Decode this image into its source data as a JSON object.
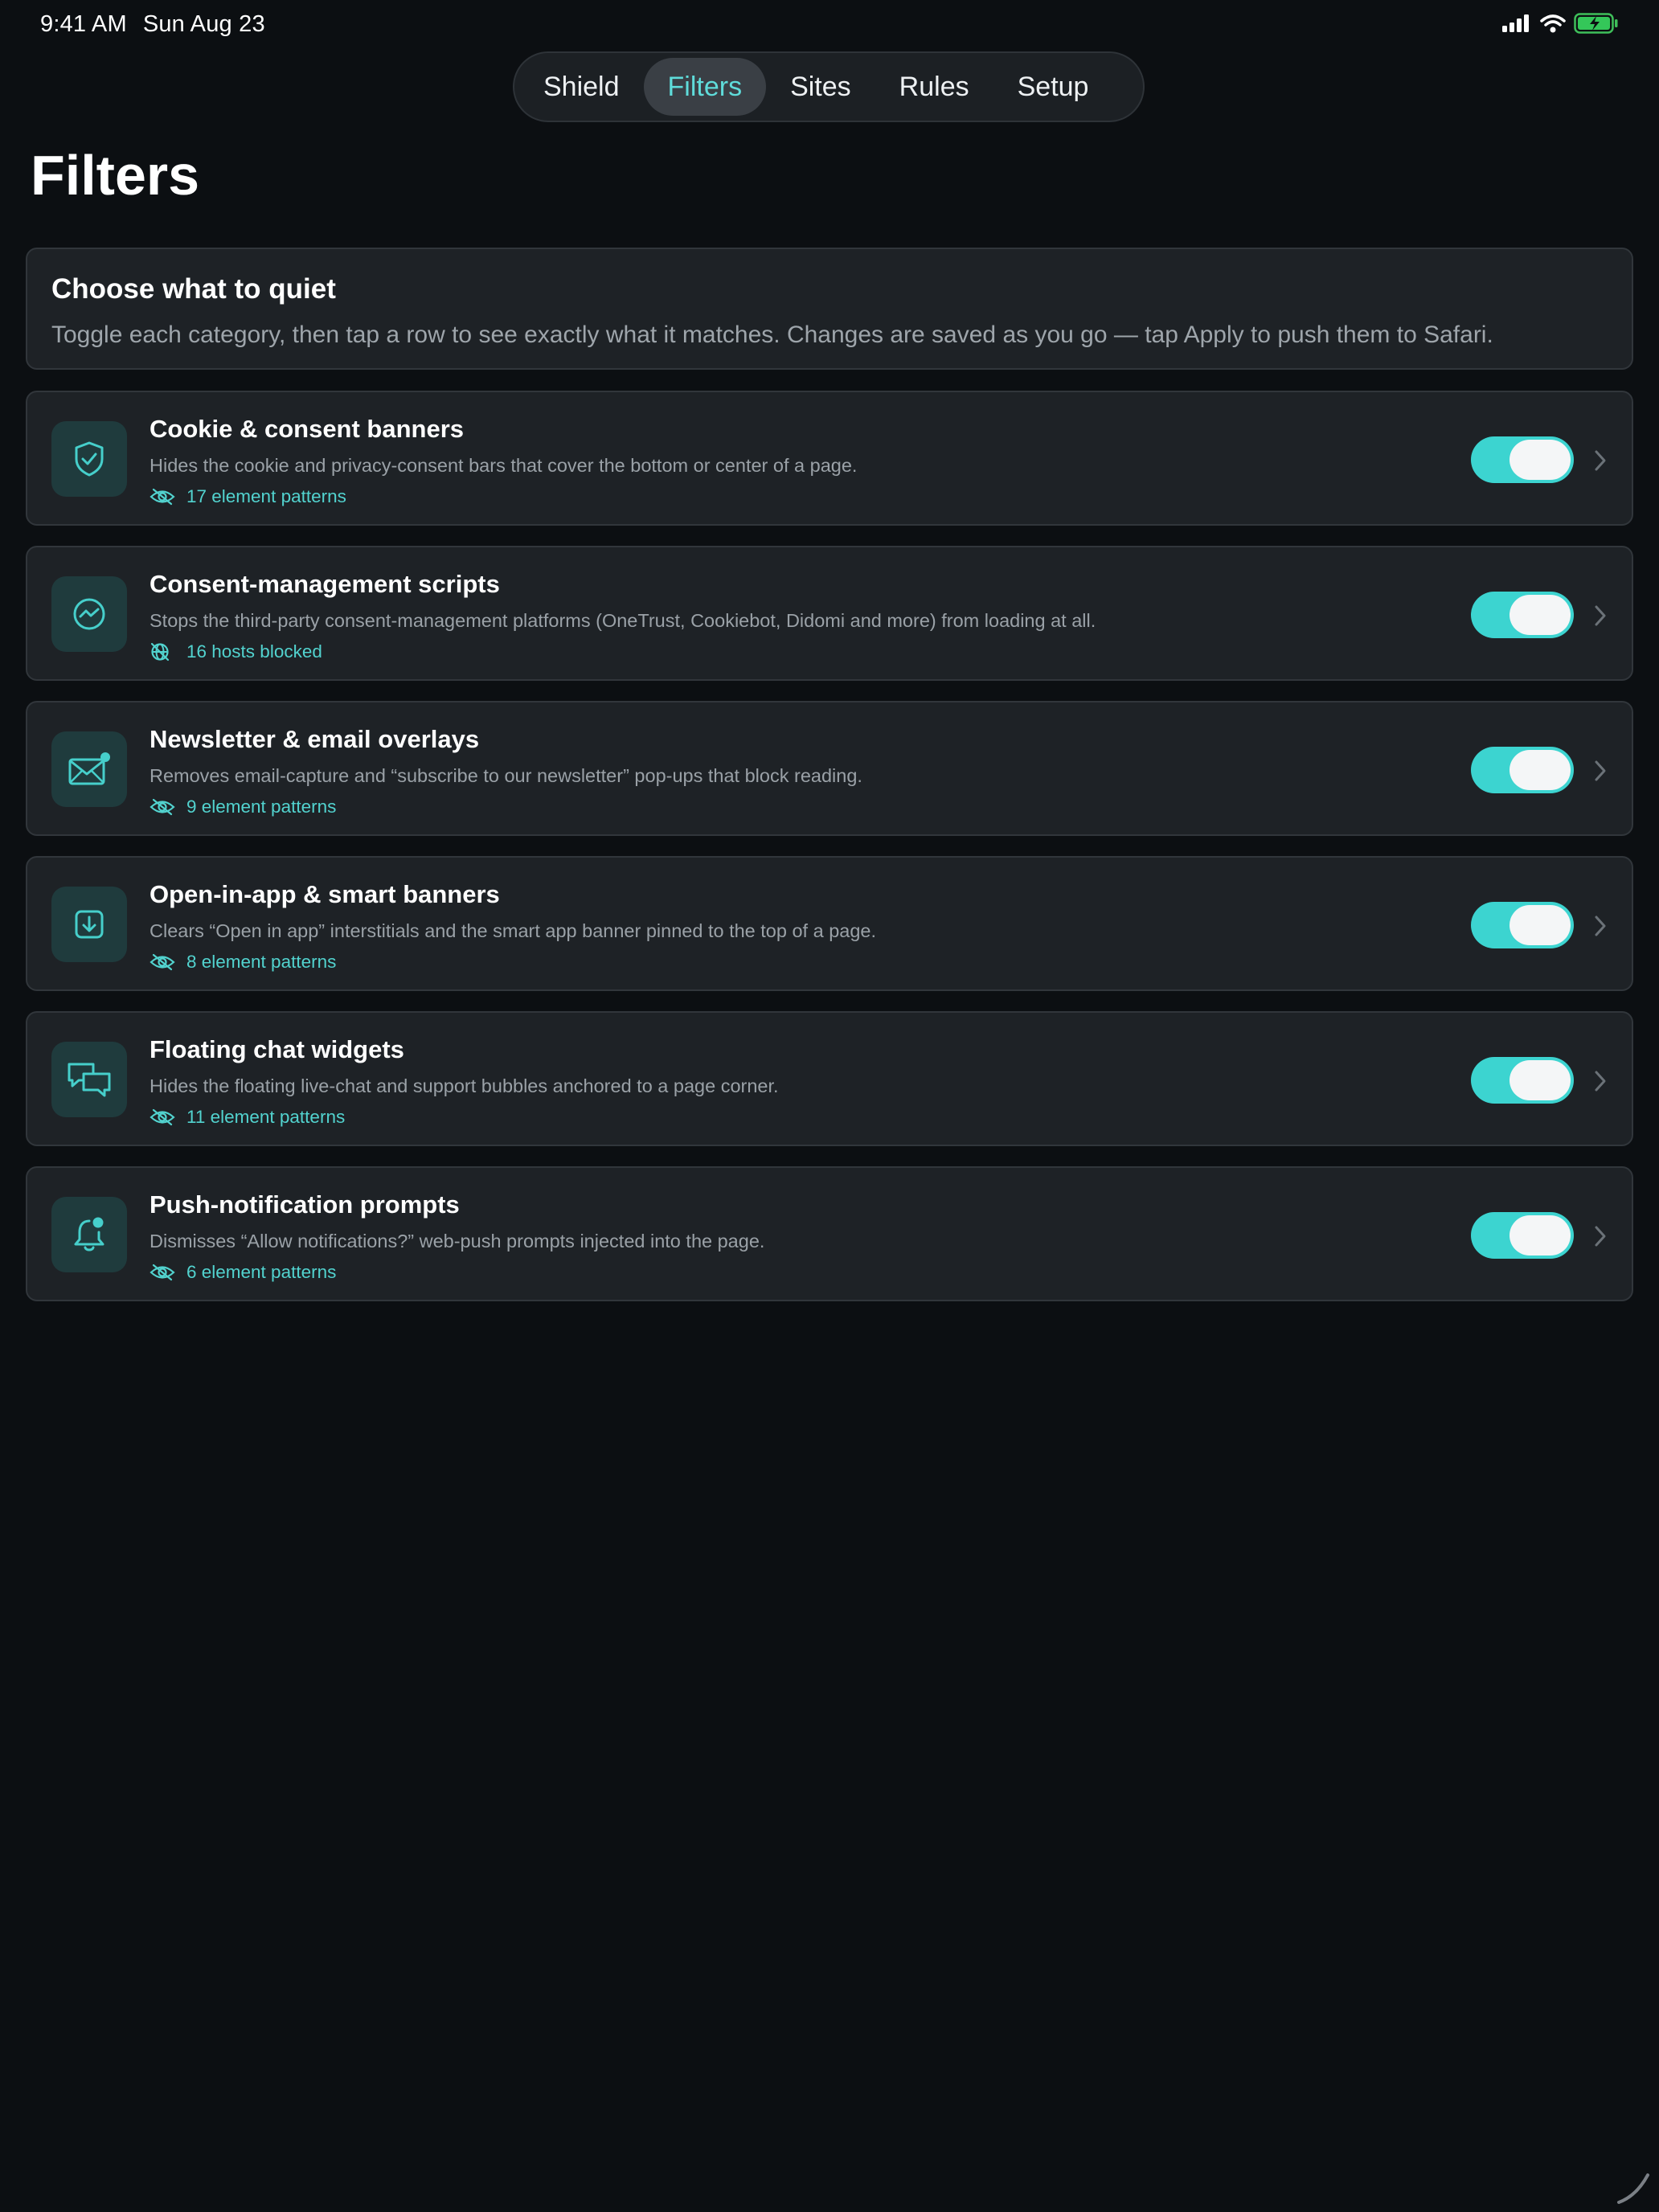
{
  "status": {
    "time": "9:41 AM",
    "date": "Sun Aug 23",
    "icons": [
      "cellular-signal-icon",
      "wifi-icon",
      "battery-charging-icon"
    ]
  },
  "tabs": [
    {
      "label": "Shield",
      "active": false
    },
    {
      "label": "Filters",
      "active": true
    },
    {
      "label": "Sites",
      "active": false
    },
    {
      "label": "Rules",
      "active": false
    },
    {
      "label": "Setup",
      "active": false
    }
  ],
  "page": {
    "title": "Filters"
  },
  "intro": {
    "heading": "Choose what to quiet",
    "text": "Toggle each category, then tap a row to see exactly what it matches. Changes are saved as you go — tap Apply to push them to Safari."
  },
  "filters": [
    {
      "title": "Cookie & consent banners",
      "description": "Hides the cookie and privacy-consent bars that cover the bottom or center of a page.",
      "meta": "17 element patterns",
      "icon": "shield-check-icon",
      "meta_icon": "eye-slash-icon",
      "enabled": true
    },
    {
      "title": "Consent-management scripts",
      "description": "Stops the third-party consent-management platforms (OneTrust, Cookiebot, Didomi and more) from loading at all.",
      "meta": "16 hosts blocked",
      "icon": "script-signal-icon",
      "meta_icon": "network-blocked-icon",
      "enabled": true
    },
    {
      "title": "Newsletter & email overlays",
      "description": "Removes email-capture and “subscribe to our newsletter” pop-ups that block reading.",
      "meta": "9 element patterns",
      "icon": "envelope-badge-icon",
      "meta_icon": "eye-slash-icon",
      "enabled": true
    },
    {
      "title": "Open-in-app & smart banners",
      "description": "Clears “Open in app” interstitials and the smart app banner pinned to the top of a page.",
      "meta": "8 element patterns",
      "icon": "download-box-icon",
      "meta_icon": "eye-slash-icon",
      "enabled": true
    },
    {
      "title": "Floating chat widgets",
      "description": "Hides the floating live-chat and support bubbles anchored to a page corner.",
      "meta": "11 element patterns",
      "icon": "chat-bubbles-icon",
      "meta_icon": "eye-slash-icon",
      "enabled": true
    },
    {
      "title": "Push-notification prompts",
      "description": "Dismisses “Allow notifications?” web-push prompts injected into the page.",
      "meta": "6 element patterns",
      "icon": "bell-badge-icon",
      "meta_icon": "eye-slash-icon",
      "enabled": true
    }
  ],
  "colors": {
    "background": "#0c0f12",
    "card": "#1e2226",
    "accent": "#3cd4d0",
    "accent_text": "#52d3cf",
    "icon_tile": "#1f3b3d"
  }
}
